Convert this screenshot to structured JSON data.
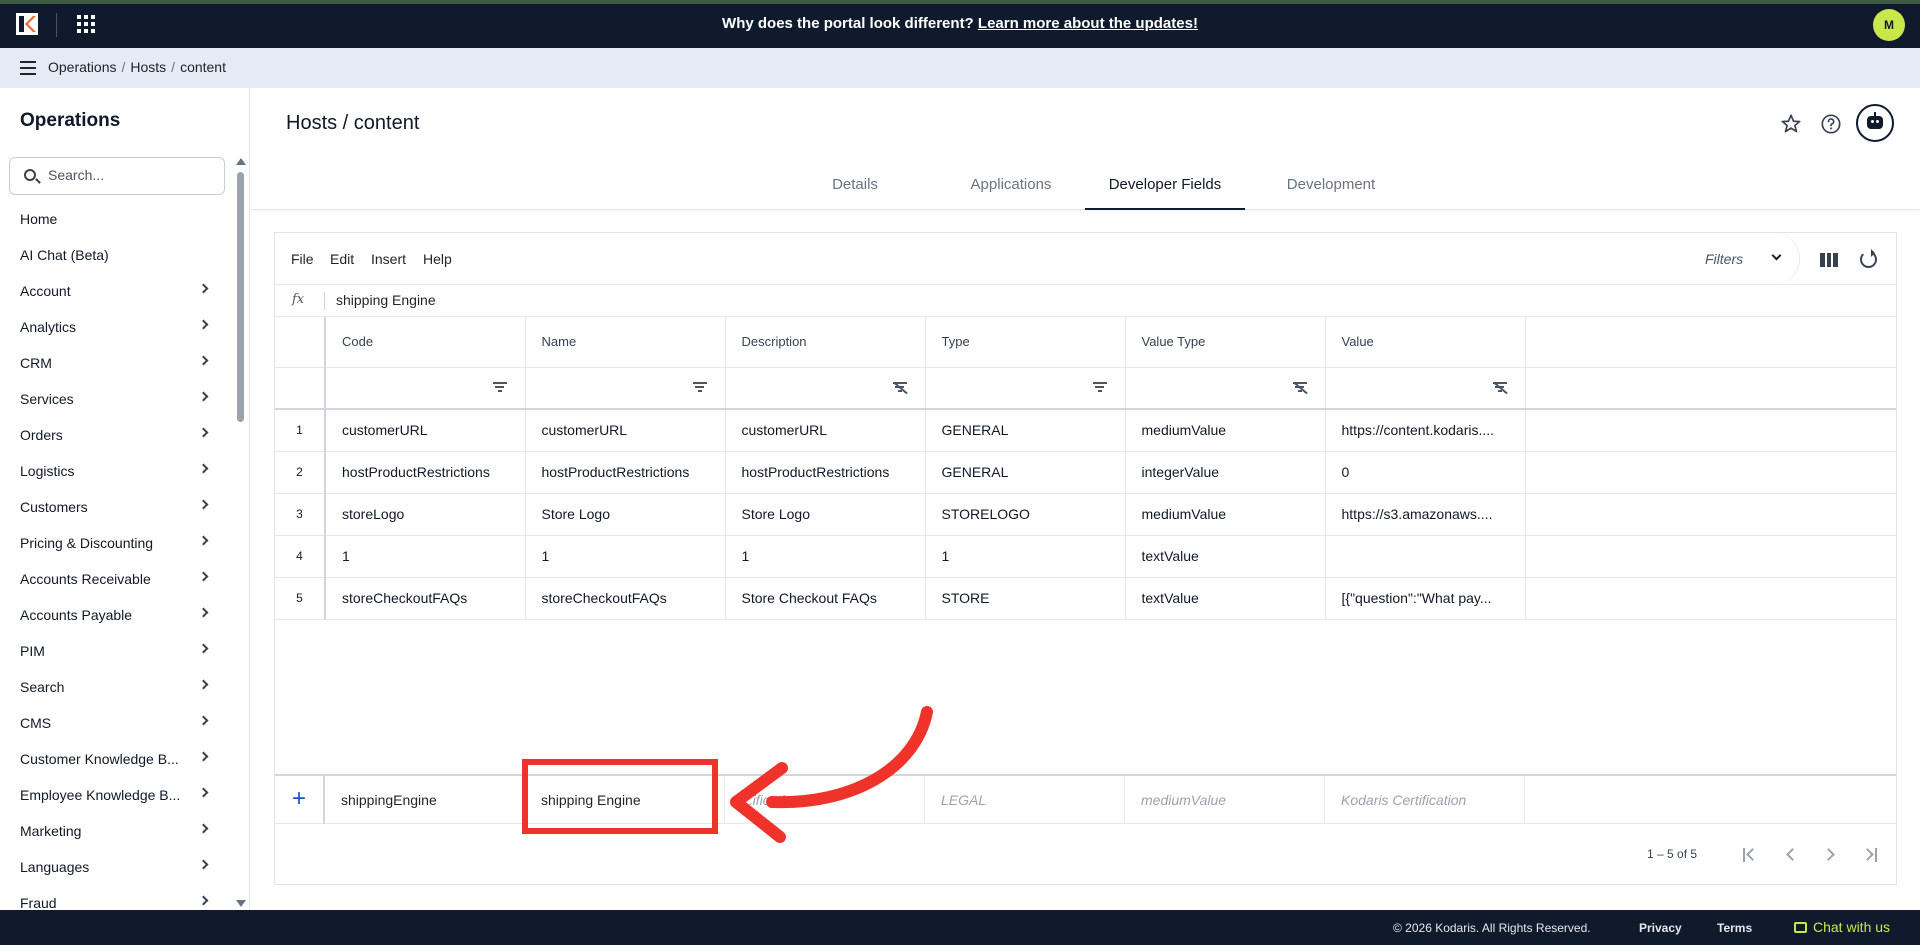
{
  "banner": {
    "text": "Why does the portal look different?",
    "link": "Learn more about the updates!",
    "user_initial": "M"
  },
  "breadcrumb": [
    "Operations",
    "Hosts",
    "content"
  ],
  "sidebar": {
    "title": "Operations",
    "search_placeholder": "Search...",
    "items": [
      {
        "label": "Home",
        "has_children": false
      },
      {
        "label": "AI Chat (Beta)",
        "has_children": false
      },
      {
        "label": "Account",
        "has_children": true
      },
      {
        "label": "Analytics",
        "has_children": true
      },
      {
        "label": "CRM",
        "has_children": true
      },
      {
        "label": "Services",
        "has_children": true
      },
      {
        "label": "Orders",
        "has_children": true
      },
      {
        "label": "Logistics",
        "has_children": true
      },
      {
        "label": "Customers",
        "has_children": true
      },
      {
        "label": "Pricing & Discounting",
        "has_children": true
      },
      {
        "label": "Accounts Receivable",
        "has_children": true
      },
      {
        "label": "Accounts Payable",
        "has_children": true
      },
      {
        "label": "PIM",
        "has_children": true
      },
      {
        "label": "Search",
        "has_children": true
      },
      {
        "label": "CMS",
        "has_children": true
      },
      {
        "label": "Customer Knowledge B...",
        "has_children": true
      },
      {
        "label": "Employee Knowledge B...",
        "has_children": true
      },
      {
        "label": "Marketing",
        "has_children": true
      },
      {
        "label": "Languages",
        "has_children": true
      },
      {
        "label": "Fraud",
        "has_children": true
      }
    ]
  },
  "page": {
    "title": "Hosts / content",
    "tabs": [
      "Details",
      "Applications",
      "Developer Fields",
      "Development"
    ],
    "active_tab": "Developer Fields"
  },
  "grid": {
    "menu": [
      "File",
      "Edit",
      "Insert",
      "Help"
    ],
    "filters_label": "Filters",
    "formula_label": "fx",
    "formula_value": "shipping Engine",
    "columns": [
      "Code",
      "Name",
      "Description",
      "Type",
      "Value Type",
      "Value"
    ],
    "rows": [
      {
        "num": "1",
        "cells": [
          "customerURL",
          "customerURL",
          "customerURL",
          "GENERAL",
          "mediumValue",
          "https://content.kodaris...."
        ]
      },
      {
        "num": "2",
        "cells": [
          "hostProductRestrictions",
          "hostProductRestrictions",
          "hostProductRestrictions",
          "GENERAL",
          "integerValue",
          "0"
        ]
      },
      {
        "num": "3",
        "cells": [
          "storeLogo",
          "Store Logo",
          "Store Logo",
          "STORELOGO",
          "mediumValue",
          "https://s3.amazonaws...."
        ]
      },
      {
        "num": "4",
        "cells": [
          "1",
          "1",
          "1",
          "1",
          "textValue",
          ""
        ]
      },
      {
        "num": "5",
        "cells": [
          "storeCheckoutFAQs",
          "storeCheckoutFAQs",
          "Store Checkout FAQs",
          "STORE",
          "textValue",
          "[{\"question\":\"What pay..."
        ]
      }
    ],
    "new_row": {
      "code": "shippingEngine",
      "name": "shipping Engine",
      "description_placeholder": "...ification",
      "type_placeholder": "LEGAL",
      "value_type_placeholder": "mediumValue",
      "value_placeholder": "Kodaris Certification"
    },
    "pagination": "1 – 5 of 5"
  },
  "annotation_color": "#f0332a",
  "footer": {
    "copyright": "© 2026 Kodaris. All Rights Reserved.",
    "privacy": "Privacy",
    "terms": "Terms",
    "chat": "Chat with us"
  }
}
